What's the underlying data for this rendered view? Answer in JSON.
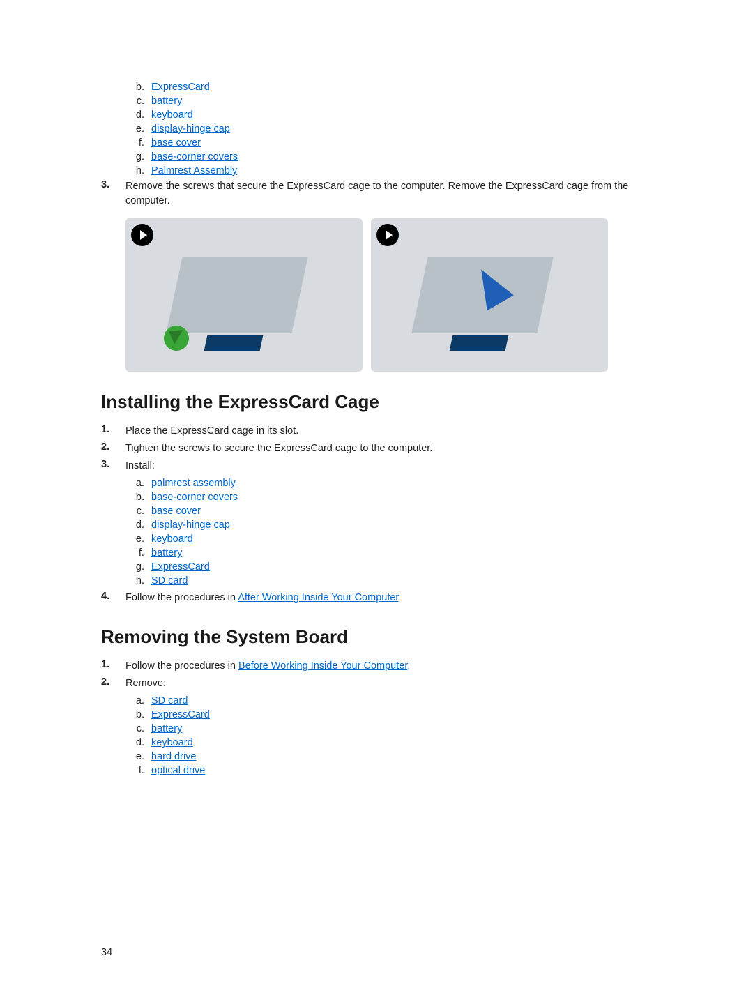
{
  "section1": {
    "list1": {
      "b": "ExpressCard",
      "c": "battery",
      "d": "keyboard",
      "e": "display-hinge cap",
      "f": "base cover",
      "g": "base-corner covers",
      "h": "Palmrest Assembly"
    },
    "step3_num": "3.",
    "step3_text": "Remove the screws that secure the ExpressCard cage to the computer. Remove the ExpressCard cage from the computer."
  },
  "section2": {
    "heading": "Installing the ExpressCard Cage",
    "step1_num": "1.",
    "step1_text": "Place the ExpressCard cage in its slot.",
    "step2_num": "2.",
    "step2_text": "Tighten the screws to secure the ExpressCard cage to the computer.",
    "step3_num": "3.",
    "step3_text": "Install:",
    "list": {
      "a": "palmrest assembly",
      "b": "base-corner covers",
      "c": "base cover",
      "d": "display-hinge cap",
      "e": "keyboard",
      "f": "battery",
      "g": "ExpressCard",
      "h": "SD card"
    },
    "step4_num": "4.",
    "step4_prefix": "Follow the procedures in ",
    "step4_link": "After Working Inside Your Computer",
    "step4_suffix": "."
  },
  "section3": {
    "heading": "Removing the System Board",
    "step1_num": "1.",
    "step1_prefix": "Follow the procedures in ",
    "step1_link": "Before Working Inside Your Computer",
    "step1_suffix": ".",
    "step2_num": "2.",
    "step2_text": "Remove:",
    "list": {
      "a": "SD card",
      "b": "ExpressCard",
      "c": "battery",
      "d": "keyboard",
      "e": "hard drive",
      "f": "optical drive"
    }
  },
  "page_number": "34"
}
